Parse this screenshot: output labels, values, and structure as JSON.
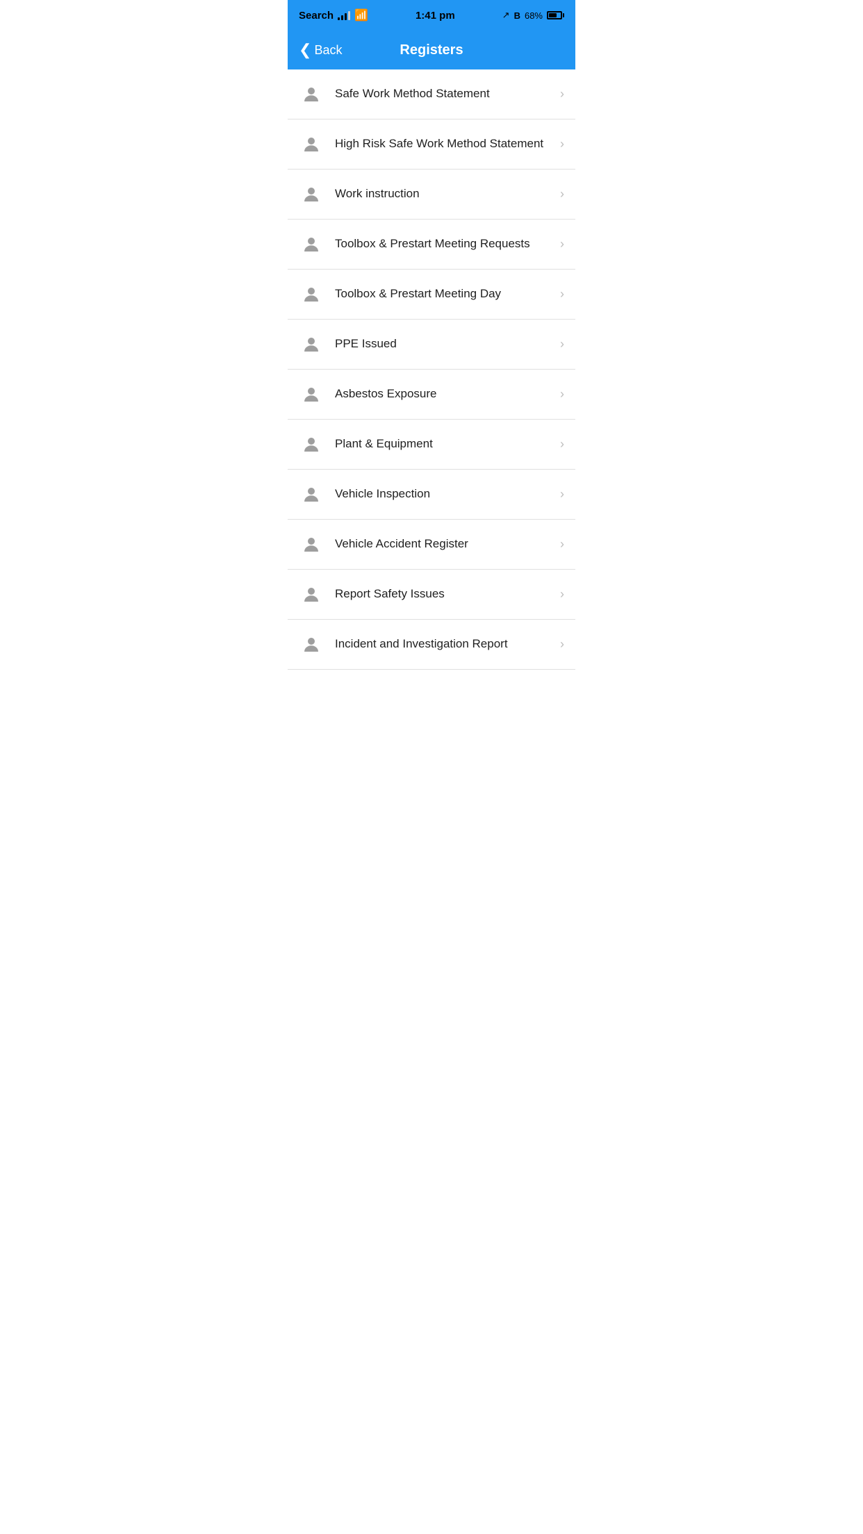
{
  "statusBar": {
    "appName": "Search",
    "time": "1:41 pm",
    "battery": "68%",
    "batteryAriaLabel": "battery at 68 percent"
  },
  "navBar": {
    "backLabel": "Back",
    "title": "Registers"
  },
  "listItems": [
    {
      "id": 1,
      "label": "Safe Work Method Statement"
    },
    {
      "id": 2,
      "label": "High Risk Safe Work Method Statement"
    },
    {
      "id": 3,
      "label": "Work instruction"
    },
    {
      "id": 4,
      "label": "Toolbox & Prestart Meeting Requests"
    },
    {
      "id": 5,
      "label": "Toolbox & Prestart Meeting Day"
    },
    {
      "id": 6,
      "label": "PPE Issued"
    },
    {
      "id": 7,
      "label": "Asbestos Exposure"
    },
    {
      "id": 8,
      "label": "Plant & Equipment"
    },
    {
      "id": 9,
      "label": "Vehicle Inspection"
    },
    {
      "id": 10,
      "label": "Vehicle Accident Register"
    },
    {
      "id": 11,
      "label": "Report Safety Issues"
    },
    {
      "id": 12,
      "label": "Incident and Investigation Report"
    }
  ],
  "colors": {
    "accent": "#2196F3",
    "background": "#ffffff",
    "text": "#212121",
    "icon": "#9e9e9e",
    "divider": "#e0e0e0",
    "chevron": "#bdbdbd",
    "navText": "#ffffff"
  }
}
